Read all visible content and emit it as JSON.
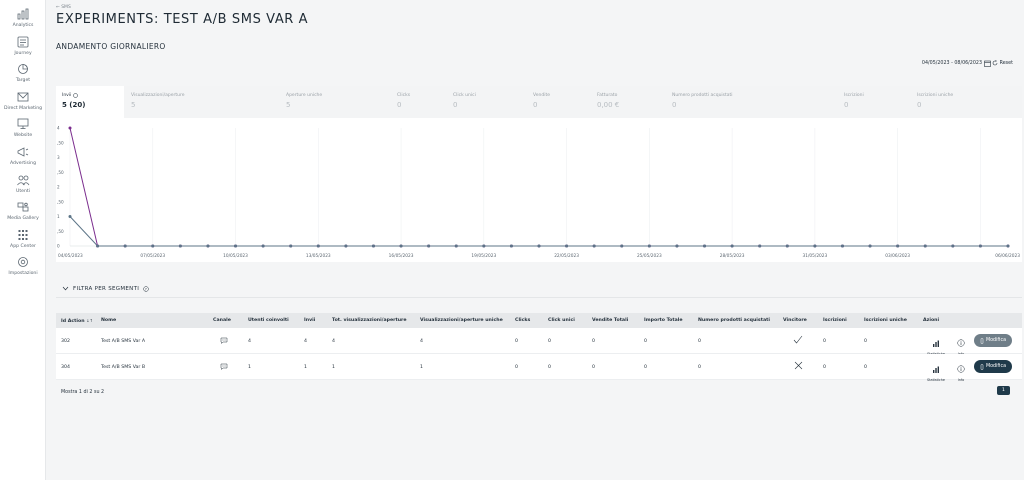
{
  "sidebar": {
    "items": [
      {
        "label": "Analytics",
        "icon": "bar-chart-icon"
      },
      {
        "label": "Journey",
        "icon": "journey-icon"
      },
      {
        "label": "Target",
        "icon": "target-icon"
      },
      {
        "label": "Direct Marketing",
        "icon": "mail-icon"
      },
      {
        "label": "Website",
        "icon": "monitor-icon"
      },
      {
        "label": "Advertising",
        "icon": "megaphone-icon"
      },
      {
        "label": "Utenti",
        "icon": "users-icon"
      },
      {
        "label": "Media Gallery",
        "icon": "media-gallery-icon"
      },
      {
        "label": "App Center",
        "icon": "grid-icon"
      },
      {
        "label": "Impostazioni",
        "icon": "gear-icon"
      }
    ]
  },
  "header": {
    "breadcrumb": "← SMS",
    "title": "EXPERIMENTS: TEST A/B SMS VAR A",
    "section_title": "ANDAMENTO GIORNALIERO",
    "date_range": "04/05/2023 - 08/06/2023",
    "reset_label": "Reset"
  },
  "kpis": [
    {
      "label": "Invii",
      "value": "5 (20)",
      "active": true
    },
    {
      "label": "Visualizzazioni/aperture",
      "value": "5",
      "active": false
    },
    {
      "label": "Aperture uniche",
      "value": "5",
      "active": false
    },
    {
      "label": "Clicks",
      "value": "0",
      "active": false
    },
    {
      "label": "Click unici",
      "value": "0",
      "active": false
    },
    {
      "label": "Vendite",
      "value": "0",
      "active": false
    },
    {
      "label": "Fatturato",
      "value": "0,00 €",
      "active": false
    },
    {
      "label": "Numero prodotti acquistati",
      "value": "0",
      "active": false
    },
    {
      "label": "Iscrizioni",
      "value": "0",
      "active": false
    },
    {
      "label": "Iscrizioni uniche",
      "value": "0",
      "active": false
    }
  ],
  "chart_data": {
    "type": "line",
    "ylim": [
      0,
      4
    ],
    "yticks": [
      "0",
      ",50",
      "1",
      ",50",
      "2",
      ",50",
      "3",
      ",50",
      "4"
    ],
    "x_labels": [
      "04/05/2023",
      "07/05/2023",
      "10/05/2023",
      "13/05/2023",
      "16/05/2023",
      "19/05/2023",
      "22/05/2023",
      "25/05/2023",
      "28/05/2023",
      "31/05/2023",
      "03/06/2023",
      "06/06/2023"
    ],
    "x_count": 35,
    "series": [
      {
        "color": "#7b2d8e",
        "values": [
          4,
          0,
          0,
          0,
          0,
          0,
          0,
          0,
          0,
          0,
          0,
          0,
          0,
          0,
          0,
          0,
          0,
          0,
          0,
          0,
          0,
          0,
          0,
          0,
          0,
          0,
          0,
          0,
          0,
          0,
          0,
          0,
          0,
          0,
          0
        ]
      },
      {
        "color": "#5c7487",
        "values": [
          1,
          0,
          0,
          0,
          0,
          0,
          0,
          0,
          0,
          0,
          0,
          0,
          0,
          0,
          0,
          0,
          0,
          0,
          0,
          0,
          0,
          0,
          0,
          0,
          0,
          0,
          0,
          0,
          0,
          0,
          0,
          0,
          0,
          0,
          0
        ]
      }
    ],
    "grid": true
  },
  "filter": {
    "label": "FILTRA PER SEGMENTI"
  },
  "table": {
    "columns": [
      "Id Action",
      "Nome",
      "Canale",
      "Utenti coinvolti",
      "Invii",
      "Tot. visualizzazioni/aperture",
      "Visualizzazioni/aperture uniche",
      "Clicks",
      "Click unici",
      "Vendite Totali",
      "Importo Totale",
      "Numero prodotti acquistati",
      "Vincitore",
      "Iscrizioni",
      "Iscrizioni uniche",
      "Azioni"
    ],
    "rows": [
      {
        "id": "302",
        "name": "Test A/B SMS Var A",
        "users": "4",
        "sends": "4",
        "views": "4",
        "unique_views": "4",
        "clicks": "0",
        "unique_clicks": "0",
        "sales": "0",
        "amount": "0",
        "products": "0",
        "winner": true,
        "subs": "0",
        "unique_subs": "0",
        "edit_style": "secondary"
      },
      {
        "id": "304",
        "name": "Test A/B SMS Var B",
        "users": "1",
        "sends": "1",
        "views": "1",
        "unique_views": "1",
        "clicks": "0",
        "unique_clicks": "0",
        "sales": "0",
        "amount": "0",
        "products": "0",
        "winner": false,
        "subs": "0",
        "unique_subs": "0",
        "edit_style": "primary"
      }
    ],
    "actions": {
      "stats_label": "Statistiche",
      "info_label": "Info",
      "edit_label": "Modifica"
    },
    "sort_icon": "↓↑"
  },
  "pagination": {
    "info": "Mostra 1 di 2 su 2",
    "current_page": "1"
  },
  "colors": {
    "primary": "#1f3a4a",
    "secondary": "#6f7e88",
    "purple": "#7b2d8e",
    "slate": "#5c7487"
  }
}
